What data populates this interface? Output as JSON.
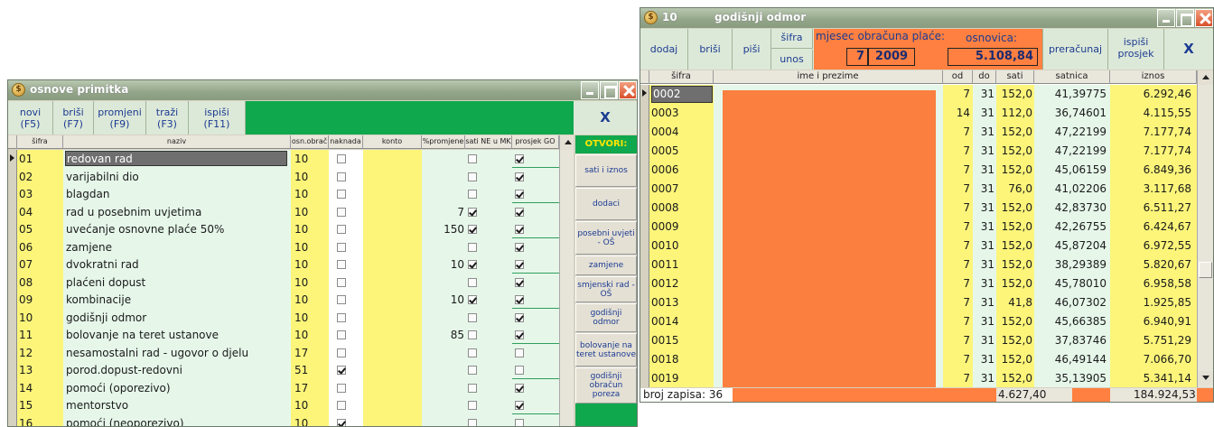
{
  "win1": {
    "title": "osnove primitka",
    "buttons": [
      {
        "l1": "novi",
        "l2": "(F5)"
      },
      {
        "l1": "briši",
        "l2": "(F7)"
      },
      {
        "l1": "promjeni",
        "l2": "(F9)"
      },
      {
        "l1": "traži",
        "l2": "(F3)"
      },
      {
        "l1": "ispiši",
        "l2": "(F11)"
      }
    ],
    "close_label": "X",
    "columns": [
      "šifra",
      "naziv",
      "osn.obrač",
      "naknada",
      "konto",
      "%promjene",
      "sati NE u MK",
      "prosjek GO"
    ],
    "rows": [
      {
        "sifra": "01",
        "naziv": "redovan rad",
        "osn": "10",
        "naknada": false,
        "konto": "",
        "promjene": "",
        "sati": false,
        "prosjek": true
      },
      {
        "sifra": "02",
        "naziv": "varijabilni dio",
        "osn": "10",
        "naknada": false,
        "konto": "",
        "promjene": "",
        "sati": false,
        "prosjek": true
      },
      {
        "sifra": "03",
        "naziv": "blagdan",
        "osn": "10",
        "naknada": false,
        "konto": "",
        "promjene": "",
        "sati": false,
        "prosjek": true
      },
      {
        "sifra": "04",
        "naziv": "rad u posebnim uvjetima",
        "osn": "10",
        "naknada": false,
        "konto": "",
        "promjene": "7",
        "sati": true,
        "prosjek": true
      },
      {
        "sifra": "05",
        "naziv": "uvećanje osnovne plaće 50%",
        "osn": "10",
        "naknada": false,
        "konto": "",
        "promjene": "150",
        "sati": true,
        "prosjek": true
      },
      {
        "sifra": "06",
        "naziv": "zamjene",
        "osn": "10",
        "naknada": false,
        "konto": "",
        "promjene": "",
        "sati": false,
        "prosjek": true
      },
      {
        "sifra": "07",
        "naziv": "dvokratni rad",
        "osn": "10",
        "naknada": false,
        "konto": "",
        "promjene": "10",
        "sati": true,
        "prosjek": true
      },
      {
        "sifra": "08",
        "naziv": "plaćeni dopust",
        "osn": "10",
        "naknada": false,
        "konto": "",
        "promjene": "",
        "sati": false,
        "prosjek": true
      },
      {
        "sifra": "09",
        "naziv": "kombinacije",
        "osn": "10",
        "naknada": false,
        "konto": "",
        "promjene": "10",
        "sati": true,
        "prosjek": true
      },
      {
        "sifra": "10",
        "naziv": "godišnji odmor",
        "osn": "10",
        "naknada": false,
        "konto": "",
        "promjene": "",
        "sati": false,
        "prosjek": true
      },
      {
        "sifra": "11",
        "naziv": "bolovanje na teret ustanove",
        "osn": "10",
        "naknada": false,
        "konto": "",
        "promjene": "85",
        "sati": false,
        "prosjek": true
      },
      {
        "sifra": "12",
        "naziv": "nesamostalni rad - ugovor o djelu",
        "osn": "17",
        "naknada": false,
        "konto": "",
        "promjene": "",
        "sati": false,
        "prosjek": false
      },
      {
        "sifra": "13",
        "naziv": "porod.dopust-redovni",
        "osn": "51",
        "naknada": true,
        "konto": "",
        "promjene": "",
        "sati": false,
        "prosjek": false
      },
      {
        "sifra": "14",
        "naziv": "pomoći (oporezivo)",
        "osn": "17",
        "naknada": false,
        "konto": "",
        "promjene": "",
        "sati": false,
        "prosjek": true
      },
      {
        "sifra": "15",
        "naziv": "mentorstvo",
        "osn": "10",
        "naknada": false,
        "konto": "",
        "promjene": "",
        "sati": false,
        "prosjek": true
      },
      {
        "sifra": "16",
        "naziv": "pomoći (neoporezivo)",
        "osn": "10",
        "naknada": true,
        "konto": "",
        "promjene": "",
        "sati": false,
        "prosjek": false
      }
    ],
    "side_header": "OTVORI:",
    "side_buttons": [
      "sati i iznos",
      "dodaci",
      "posebni uvjeti - OŠ",
      "zamjene",
      "smjenski rad - OŠ",
      "godišnji odmor",
      "bolovanje na teret ustanove",
      "godišnji obračun poreza"
    ],
    "colors": {
      "yellow": "#fcf57a",
      "mint": "#e6f7ea",
      "green": "#0fa84d",
      "selected": "#6f6f6f"
    }
  },
  "win2": {
    "title_num": "10",
    "title": "godišnji odmor",
    "buttons": [
      "dodaj",
      "briši",
      "piši"
    ],
    "sifra_label": "šifra",
    "unos_label": "unos",
    "mjesec_label": "mjesec obračuna plaće:",
    "mjesec_value": "7",
    "godina_value": "2009",
    "osnovica_label": "osnovica:",
    "osnovica_value": "5.108,84",
    "preracunaj": "preračunaj",
    "ispisi_l1": "ispiši",
    "ispisi_l2": "prosjek",
    "close_label": "X",
    "columns": [
      "šifra",
      "ime i prezime",
      "od",
      "do",
      "sati",
      "satnica",
      "iznos"
    ],
    "rows": [
      {
        "sifra": "0002",
        "od": "7",
        "do": "31",
        "sati": "152,0",
        "satnica": "41,39775",
        "iznos": "6.292,46"
      },
      {
        "sifra": "0003",
        "od": "14",
        "do": "31",
        "sati": "112,0",
        "satnica": "36,74601",
        "iznos": "4.115,55"
      },
      {
        "sifra": "0004",
        "od": "7",
        "do": "31",
        "sati": "152,0",
        "satnica": "47,22199",
        "iznos": "7.177,74"
      },
      {
        "sifra": "0005",
        "od": "7",
        "do": "31",
        "sati": "152,0",
        "satnica": "47,22199",
        "iznos": "7.177,74"
      },
      {
        "sifra": "0006",
        "od": "7",
        "do": "31",
        "sati": "152,0",
        "satnica": "45,06159",
        "iznos": "6.849,36"
      },
      {
        "sifra": "0007",
        "od": "7",
        "do": "31",
        "sati": "76,0",
        "satnica": "41,02206",
        "iznos": "3.117,68"
      },
      {
        "sifra": "0008",
        "od": "7",
        "do": "31",
        "sati": "152,0",
        "satnica": "42,83730",
        "iznos": "6.511,27"
      },
      {
        "sifra": "0009",
        "od": "7",
        "do": "31",
        "sati": "152,0",
        "satnica": "42,26755",
        "iznos": "6.424,67"
      },
      {
        "sifra": "0010",
        "od": "7",
        "do": "31",
        "sati": "152,0",
        "satnica": "45,87204",
        "iznos": "6.972,55"
      },
      {
        "sifra": "0011",
        "od": "7",
        "do": "31",
        "sati": "152,0",
        "satnica": "38,29389",
        "iznos": "5.820,67"
      },
      {
        "sifra": "0012",
        "od": "7",
        "do": "31",
        "sati": "152,0",
        "satnica": "45,78010",
        "iznos": "6.958,58"
      },
      {
        "sifra": "0013",
        "od": "7",
        "do": "31",
        "sati": "41,8",
        "satnica": "46,07302",
        "iznos": "1.925,85"
      },
      {
        "sifra": "0014",
        "od": "7",
        "do": "31",
        "sati": "152,0",
        "satnica": "45,66385",
        "iznos": "6.940,91"
      },
      {
        "sifra": "0015",
        "od": "7",
        "do": "31",
        "sati": "152,0",
        "satnica": "37,83746",
        "iznos": "5.751,29"
      },
      {
        "sifra": "0018",
        "od": "7",
        "do": "31",
        "sati": "152,0",
        "satnica": "46,49144",
        "iznos": "7.066,70"
      },
      {
        "sifra": "0019",
        "od": "7",
        "do": "31",
        "sati": "152,0",
        "satnica": "35,13905",
        "iznos": "5.341,14"
      }
    ],
    "footer": {
      "broj_label": "broj zapisa: 36",
      "total_sati": "4.627,40",
      "total_iznos": "184.924,53"
    },
    "colors": {
      "yellow": "#fcf57a",
      "mint": "#e6f7ea",
      "orange": "#ff8040",
      "redacted": "#fb7f3f"
    }
  }
}
